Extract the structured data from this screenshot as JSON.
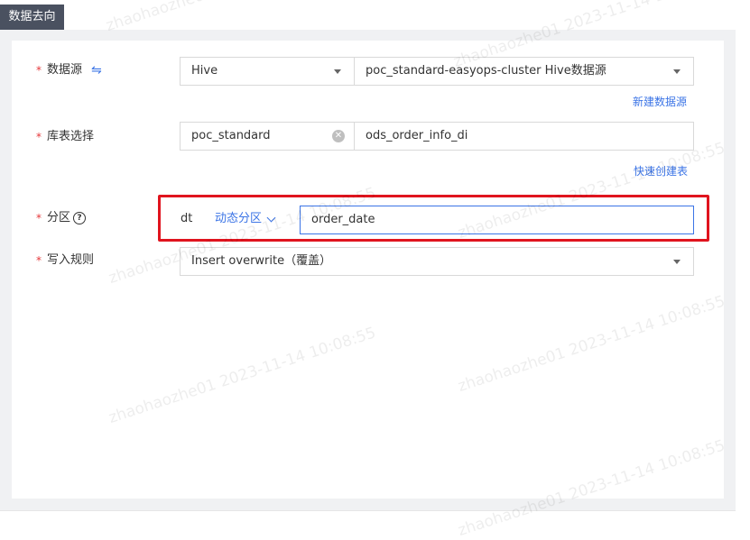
{
  "section": {
    "title": "数据去向"
  },
  "form": {
    "datasource": {
      "required": "*",
      "label": "数据源",
      "swap_icon": "⇋",
      "type_value": "Hive",
      "source_value": "poc_standard-easyops-cluster Hive数据源",
      "new_link": "新建数据源"
    },
    "table": {
      "required": "*",
      "label": "库表选择",
      "db_value": "poc_standard",
      "table_value": "ods_order_info_di",
      "quick_link": "快速创建表"
    },
    "partition": {
      "required": "*",
      "label": "分区",
      "help_icon": "?",
      "name": "dt",
      "mode": "动态分区",
      "value": "order_date"
    },
    "write_rule": {
      "required": "*",
      "label": "写入规则",
      "value": "Insert overwrite（覆盖）"
    }
  },
  "watermark": {
    "text": "zhaohaozhe01 2023-11-14 10:08:55"
  }
}
